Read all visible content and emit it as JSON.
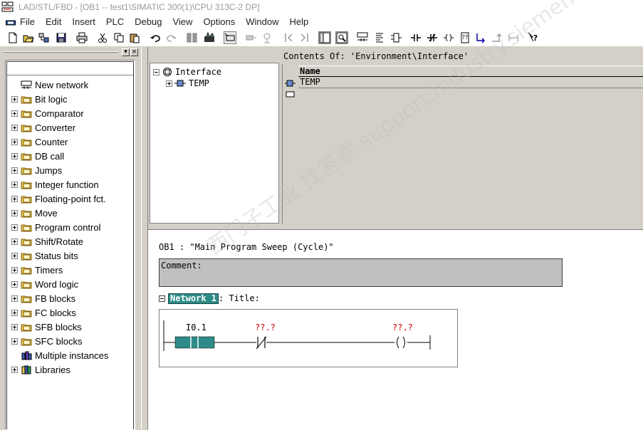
{
  "window": {
    "title": "LAD/STL/FBD  - [OB1 -- test1\\SIMATIC 300(1)\\CPU 313C-2 DP]"
  },
  "menu": [
    "File",
    "Edit",
    "Insert",
    "PLC",
    "Debug",
    "View",
    "Options",
    "Window",
    "Help"
  ],
  "toolbar_icons": [
    "new-icon",
    "open-icon",
    "online-icon",
    "save-icon",
    "print-icon",
    "cut-icon",
    "copy-icon",
    "paste-icon",
    "undo-icon",
    "redo-icon",
    "load-icon",
    "compile-icon",
    "monitor-icon",
    "step-back-icon",
    "step-forward-icon",
    "overview-icon",
    "details-icon",
    "new-network-icon",
    "ladder-icon",
    "stl-icon",
    "no-contact-icon",
    "nc-contact-icon",
    "coil-icon",
    "empty-box-icon",
    "open-branch-icon",
    "close-branch-icon",
    "conn-icon",
    "help-icon"
  ],
  "element_tree": {
    "items": [
      {
        "label": "New network",
        "icon": "new-network-icon",
        "expandable": false
      },
      {
        "label": "Bit logic",
        "icon": "bit-logic-icon",
        "expandable": true
      },
      {
        "label": "Comparator",
        "icon": "comparator-icon",
        "expandable": true
      },
      {
        "label": "Converter",
        "icon": "converter-icon",
        "expandable": true
      },
      {
        "label": "Counter",
        "icon": "counter-icon",
        "expandable": true
      },
      {
        "label": "DB call",
        "icon": "db-call-icon",
        "expandable": true
      },
      {
        "label": "Jumps",
        "icon": "jumps-icon",
        "expandable": true
      },
      {
        "label": "Integer function",
        "icon": "integer-function-icon",
        "expandable": true
      },
      {
        "label": "Floating-point fct.",
        "icon": "floating-point-icon",
        "expandable": true
      },
      {
        "label": "Move",
        "icon": "move-icon",
        "expandable": true
      },
      {
        "label": "Program control",
        "icon": "program-control-icon",
        "expandable": true
      },
      {
        "label": "Shift/Rotate",
        "icon": "shift-rotate-icon",
        "expandable": true
      },
      {
        "label": "Status bits",
        "icon": "status-bits-icon",
        "expandable": true
      },
      {
        "label": "Timers",
        "icon": "timers-icon",
        "expandable": true
      },
      {
        "label": "Word logic",
        "icon": "word-logic-icon",
        "expandable": true
      },
      {
        "label": "FB blocks",
        "icon": "fb-blocks-icon",
        "expandable": true
      },
      {
        "label": "FC blocks",
        "icon": "fc-blocks-icon",
        "expandable": true
      },
      {
        "label": "SFB blocks",
        "icon": "sfb-blocks-icon",
        "expandable": true
      },
      {
        "label": "SFC blocks",
        "icon": "sfc-blocks-icon",
        "expandable": true
      },
      {
        "label": "Multiple instances",
        "icon": "multiple-instances-icon",
        "expandable": false
      },
      {
        "label": "Libraries",
        "icon": "libraries-icon",
        "expandable": true
      }
    ]
  },
  "interface": {
    "root": "Interface",
    "child": "TEMP",
    "contents_title": "Contents Of: 'Environment\\Interface'",
    "column_header": "Name",
    "rows": [
      "TEMP"
    ]
  },
  "editor": {
    "ob_title": "OB1 :  \"Main Program Sweep (Cycle)\"",
    "comment_label": "Comment:",
    "network_label": "Network 1",
    "network_title": ": Title:",
    "contact_address": "I0.1",
    "nc_contact_address": "??.?",
    "coil_address": "??.?"
  },
  "watermark": "西门子工业  找答案  support.industry.siemens.com/cs",
  "colors": {
    "network_badge": "#2e8b87",
    "placeholder_red": "#cc0000",
    "selected_contact": "#2e8b87"
  }
}
